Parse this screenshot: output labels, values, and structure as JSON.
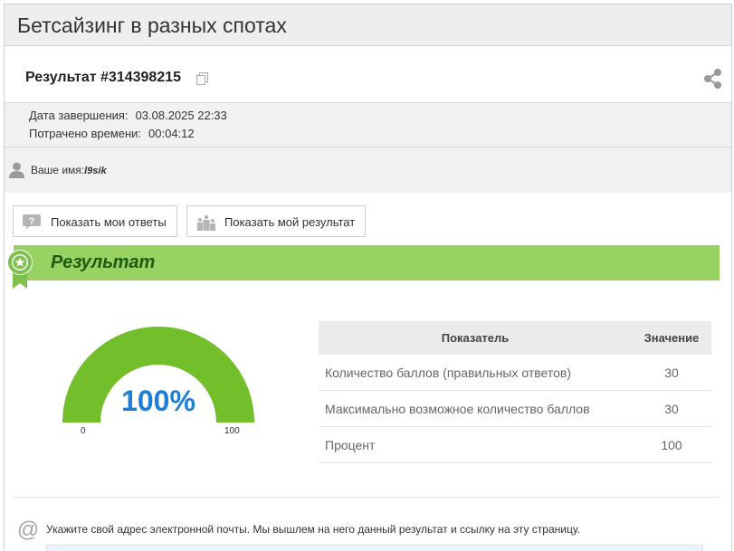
{
  "page": {
    "title": "Бетсайзинг в разных спотах"
  },
  "result": {
    "id_label": "Результат #314398215"
  },
  "meta": {
    "completed_label": "Дата завершения:",
    "completed_value": "03.08.2025 22:33",
    "spent_label": "Потрачено времени:",
    "spent_value": "00:04:12"
  },
  "user": {
    "label": "Ваше имя:",
    "name": "l9sik"
  },
  "buttons": {
    "show_answers": "Показать мои ответы",
    "show_result": "Показать мой результат"
  },
  "banner": {
    "label": "Результат"
  },
  "gauge": {
    "percent_label": "100%",
    "value": 100,
    "min_label": "0",
    "max_label": "100",
    "color": "#72bf2b"
  },
  "table": {
    "headers": [
      "Показатель",
      "Значение"
    ],
    "rows": [
      {
        "name": "Количество баллов (правильных ответов)",
        "value": "30"
      },
      {
        "name": "Максимально возможное количество баллов",
        "value": "30"
      },
      {
        "name": "Процент",
        "value": "100"
      }
    ]
  },
  "email": {
    "prompt": "Укажите свой адрес электронной почты. Мы вышлем на него данный результат и ссылку на эту страницу."
  },
  "icons": [
    "copy-icon",
    "share-icon",
    "user-icon",
    "question-icon",
    "podium-icon",
    "award-badge-icon",
    "at-icon"
  ]
}
